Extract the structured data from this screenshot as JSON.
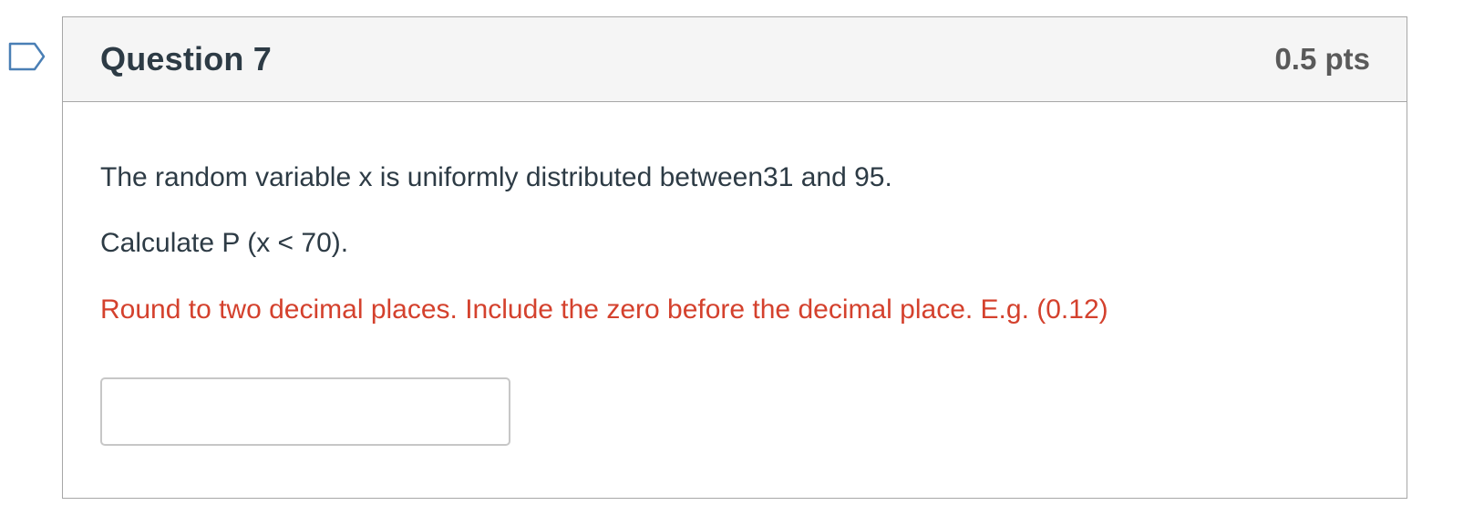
{
  "question": {
    "title": "Question 7",
    "points": "0.5 pts",
    "text_line1": "The random variable x is uniformly distributed between31 and 95.",
    "text_line2": "Calculate P (x < 70).",
    "instruction": "Round to two decimal places. Include the zero before the decimal place. E.g. (0.12)",
    "answer": {
      "value": "",
      "placeholder": ""
    }
  },
  "colors": {
    "title": "#2d3b45",
    "points": "#5a5a5a",
    "instruction": "#d4412d",
    "flag": "#4a7fb5"
  },
  "icons": {
    "flag": "bookmark-flag-icon"
  }
}
